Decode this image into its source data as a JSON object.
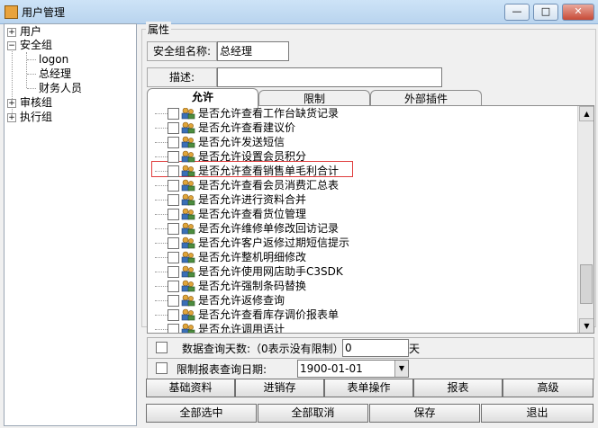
{
  "window": {
    "title": "用户管理",
    "buttons": {
      "minimize": "—",
      "maximize": "□",
      "close": "✕"
    }
  },
  "tree": {
    "nodes": [
      {
        "label": "用户",
        "toggle": "+"
      },
      {
        "label": "安全组",
        "toggle": "−"
      },
      {
        "label": "logon"
      },
      {
        "label": "总经理"
      },
      {
        "label": "财务人员"
      },
      {
        "label": "审核组",
        "toggle": "+"
      },
      {
        "label": "执行组",
        "toggle": "+"
      }
    ]
  },
  "properties": {
    "legend": "属性",
    "group_name_label": "安全组名称:",
    "group_name_value": "总经理",
    "description_label": "描述:",
    "description_value": ""
  },
  "tabs": [
    "允许",
    "限制",
    "外部插件"
  ],
  "permissions": [
    "是否允许查看工作台缺货记录",
    "是否允许查看建议价",
    "是否允许发送短信",
    "是否允许设置会员积分",
    "是否允许查看销售单毛利合计",
    "是否允许查看会员消费汇总表",
    "是否允许进行资料合并",
    "是否允许查看货位管理",
    "是否允许维修单修改回访记录",
    "是否允许客户返修过期短信提示",
    "是否允许整机明细修改",
    "是否允许使用网店助手C3SDK",
    "是否允许强制条码替换",
    "是否允许返修查询",
    "是否允许查看库存调价报表单",
    "是否允许调用语计"
  ],
  "options": {
    "query_days_label": "数据查询天数:（0表示没有限制）",
    "query_days_value": "0",
    "query_days_unit": "天",
    "report_date_label": "限制报表查询日期:",
    "report_date_value": "1900-01-01"
  },
  "category_buttons": [
    "基础资料",
    "进销存",
    "表单操作",
    "报表",
    "高级"
  ],
  "action_buttons": [
    "全部选中",
    "全部取消",
    "保存",
    "退出"
  ],
  "colors": {
    "highlight": "#e03c3c",
    "titlebar": "#c4dcf3"
  }
}
